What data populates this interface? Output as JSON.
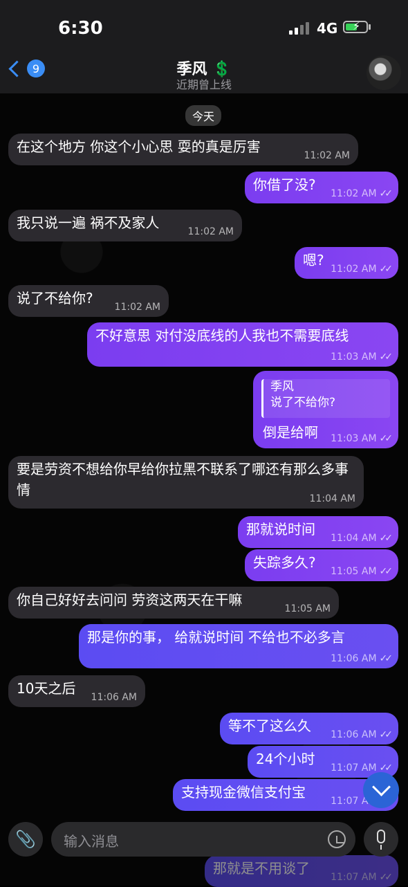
{
  "status": {
    "time": "6:30",
    "network": "4G"
  },
  "header": {
    "back_count": "9",
    "title": "季风 💲",
    "subtitle": "近期曾上线"
  },
  "date_separator": "今天",
  "messages": [
    {
      "dir": "in",
      "text": "在这个地方 你这个小心思 耍的真是厉害",
      "time": "11:02 AM"
    },
    {
      "dir": "out",
      "text": "你借了没?",
      "time": "11:02 AM"
    },
    {
      "dir": "in",
      "text": "我只说一遍 祸不及家人",
      "time": "11:02 AM"
    },
    {
      "dir": "out",
      "text": "嗯?",
      "time": "11:02 AM"
    },
    {
      "dir": "in",
      "text": "说了不给你?",
      "time": "11:02 AM"
    },
    {
      "dir": "out",
      "text": "不好意思 对付没底线的人我也不需要底线",
      "time": "11:03 AM"
    },
    {
      "dir": "out",
      "text": "倒是给啊",
      "time": "11:03 AM",
      "reply_name": "季风",
      "reply_text": "说了不给你?"
    },
    {
      "dir": "in",
      "text": "要是劳资不想给你早给你拉黑不联系了哪还有那么多事情",
      "time": "11:04 AM"
    },
    {
      "dir": "out",
      "text": "那就说时间",
      "time": "11:04 AM"
    },
    {
      "dir": "out",
      "text": "失踪多久?",
      "time": "11:05 AM"
    },
    {
      "dir": "in",
      "text": "你自己好好去问问 劳资这两天在干嘛",
      "time": "11:05 AM"
    },
    {
      "dir": "out",
      "text": "那是你的事， 给就说时间 不给也不必多言",
      "time": "11:06 AM"
    },
    {
      "dir": "in",
      "text": "10天之后",
      "time": "11:06 AM"
    },
    {
      "dir": "out",
      "text": "等不了这么久",
      "time": "11:06 AM"
    },
    {
      "dir": "out",
      "text": "24个小时",
      "time": "11:07 AM"
    },
    {
      "dir": "out",
      "text": "支持现金微信支付宝",
      "time": "11:07 AM"
    },
    {
      "dir": "out",
      "text": "那就是不用谈了",
      "time": "11:07 AM"
    }
  ],
  "input": {
    "placeholder": "输入消息"
  },
  "icons": [
    "back-chevron-icon",
    "avatar",
    "double-check-icon",
    "scroll-down-icon",
    "attach-icon",
    "sticker-icon",
    "mic-icon"
  ],
  "colors": {
    "accent": "#3a8df5",
    "outgoing": "#8a46f2",
    "incoming": "#2c2a2f"
  }
}
